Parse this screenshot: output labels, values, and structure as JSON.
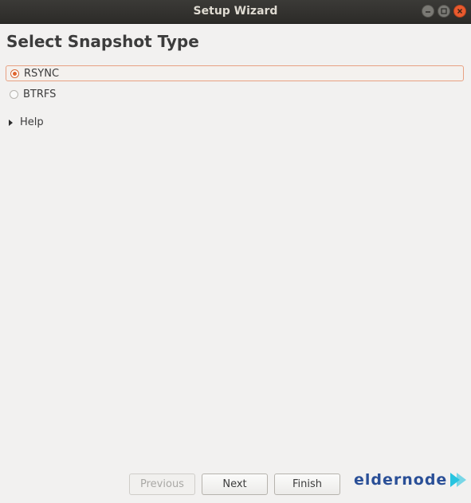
{
  "window": {
    "title": "Setup Wizard"
  },
  "page": {
    "heading": "Select Snapshot Type"
  },
  "snapshot_options": [
    {
      "label": "RSYNC",
      "selected": true
    },
    {
      "label": "BTRFS",
      "selected": false
    }
  ],
  "help": {
    "label": "Help",
    "icon": "triangle-right-icon"
  },
  "buttons": {
    "previous": "Previous",
    "next": "Next",
    "finish": "Finish"
  },
  "watermark": {
    "text": "eldernode"
  },
  "colors": {
    "accent": "#e0652f",
    "titlebar": "#2f2e2b",
    "logo": "#2a4f97",
    "logo_arrow": "#27c4e0"
  }
}
